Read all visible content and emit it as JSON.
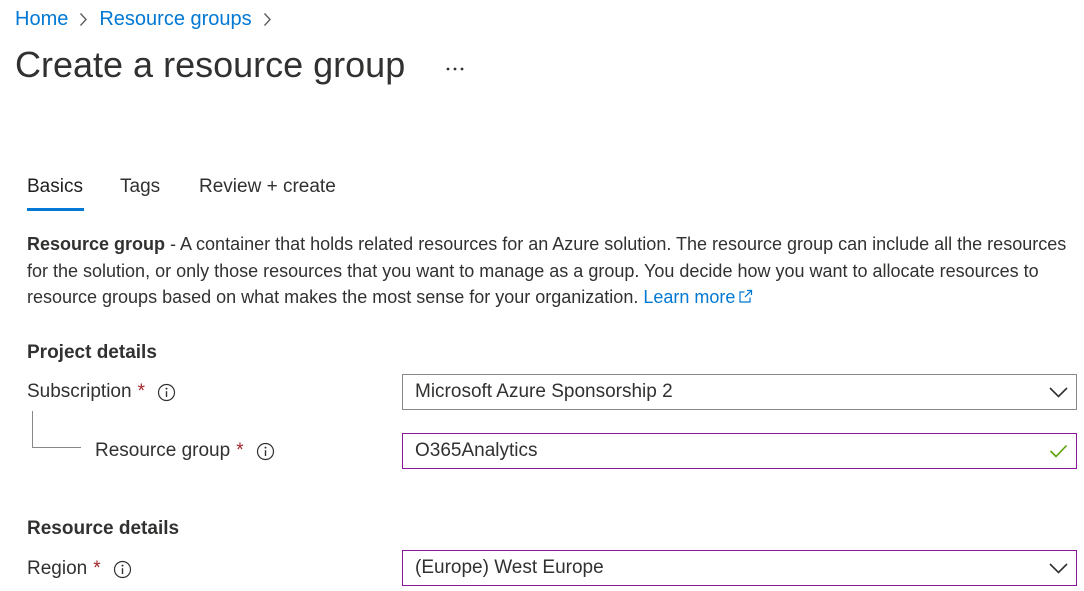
{
  "breadcrumb": {
    "items": [
      "Home",
      "Resource groups"
    ]
  },
  "page": {
    "title": "Create a resource group",
    "more_label": "..."
  },
  "tabs": [
    {
      "label": "Basics",
      "active": true
    },
    {
      "label": "Tags",
      "active": false
    },
    {
      "label": "Review + create",
      "active": false
    }
  ],
  "description": {
    "term": "Resource group",
    "text": " - A container that holds related resources for an Azure solution. The resource group can include all the resources for the solution, or only those resources that you want to manage as a group. You decide how you want to allocate resources to resource groups based on what makes the most sense for your organization. ",
    "link": "Learn more"
  },
  "project_details": {
    "heading": "Project details",
    "subscription": {
      "label": "Subscription",
      "required_mark": "*",
      "value": "Microsoft Azure Sponsorship 2"
    },
    "resource_group": {
      "label": "Resource group",
      "required_mark": "*",
      "value": "O365Analytics"
    }
  },
  "resource_details": {
    "heading": "Resource details",
    "region": {
      "label": "Region",
      "required_mark": "*",
      "value": "(Europe) West Europe"
    }
  },
  "colors": {
    "accent": "#0078d4",
    "required": "#a4262c",
    "valid_border": "#881798",
    "valid_check": "#57a300"
  },
  "icons": {
    "breadcrumb_separator": "chevron-right-icon",
    "info": "info-icon",
    "dropdown": "chevron-down-icon",
    "valid": "checkmark-icon",
    "external_link": "external-link-icon"
  }
}
